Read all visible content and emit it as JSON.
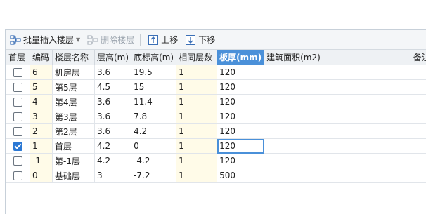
{
  "toolbar": {
    "batch_insert_label": "批量插入楼层",
    "delete_label": "删除楼层",
    "move_up_label": "上移",
    "move_down_label": "下移"
  },
  "columns": [
    "首层",
    "编码",
    "楼层名称",
    "层高(m)",
    "底标高(m)",
    "相同层数",
    "板厚(mm)",
    "建筑面积(m2)",
    "备注"
  ],
  "rows": [
    {
      "first": false,
      "code": "6",
      "name": "机房层",
      "height": "3.6",
      "base": "19.5",
      "same": "1",
      "slab": "120",
      "area": "",
      "note": ""
    },
    {
      "first": false,
      "code": "5",
      "name": "第5层",
      "height": "4.5",
      "base": "15",
      "same": "1",
      "slab": "120",
      "area": "",
      "note": ""
    },
    {
      "first": false,
      "code": "4",
      "name": "第4层",
      "height": "3.6",
      "base": "11.4",
      "same": "1",
      "slab": "120",
      "area": "",
      "note": ""
    },
    {
      "first": false,
      "code": "3",
      "name": "第3层",
      "height": "3.6",
      "base": "7.8",
      "same": "1",
      "slab": "120",
      "area": "",
      "note": ""
    },
    {
      "first": false,
      "code": "2",
      "name": "第2层",
      "height": "3.6",
      "base": "4.2",
      "same": "1",
      "slab": "120",
      "area": "",
      "note": ""
    },
    {
      "first": true,
      "code": "1",
      "name": "首层",
      "height": "4.2",
      "base": "0",
      "same": "1",
      "slab": "120",
      "area": "",
      "note": ""
    },
    {
      "first": false,
      "code": "-1",
      "name": "第-1层",
      "height": "4.2",
      "base": "-4.2",
      "same": "1",
      "slab": "120",
      "area": "",
      "note": ""
    },
    {
      "first": false,
      "code": "0",
      "name": "基础层",
      "height": "3",
      "base": "-7.2",
      "same": "1",
      "slab": "500",
      "area": "",
      "note": ""
    }
  ],
  "colors": {
    "header_highlight": "#4a90d9",
    "editable_bg": "#fffbe8",
    "check_blue": "#2b78d4"
  }
}
